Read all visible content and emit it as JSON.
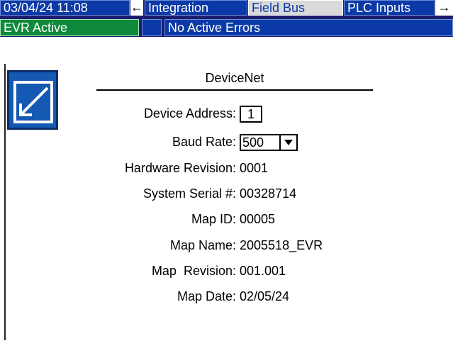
{
  "header": {
    "datetime": "03/04/24 11:08",
    "prev_arrow": "←",
    "tabs": [
      {
        "label": "Integration"
      },
      {
        "label": "Field Bus"
      },
      {
        "label": "PLC Inputs"
      }
    ],
    "next_arrow": "→",
    "status": "EVR Active",
    "errors": "No Active Errors"
  },
  "page": {
    "title": "DeviceNet",
    "edit_icon": "edit-icon",
    "fields": {
      "device_address": {
        "label": "Device Address:",
        "value": "1"
      },
      "baud_rate": {
        "label": "Baud Rate:",
        "value": "500"
      },
      "hardware_revision": {
        "label": "Hardware Revision:",
        "value": "0001"
      },
      "system_serial": {
        "label": "System Serial #:",
        "value": "00328714"
      },
      "map_id": {
        "label": "Map ID:",
        "value": "00005"
      },
      "map_name": {
        "label": "Map Name:",
        "value": "2005518_EVR"
      },
      "map_revision": {
        "label": "Map  Revision:",
        "value": "001.001"
      },
      "map_date": {
        "label": "Map Date:",
        "value": "02/05/24"
      }
    }
  },
  "colors": {
    "header_bg": "#1c1c6e",
    "tab_blue": "#0b3aa8",
    "status_green": "#0f8a3c",
    "button_blue": "#1459b3"
  }
}
